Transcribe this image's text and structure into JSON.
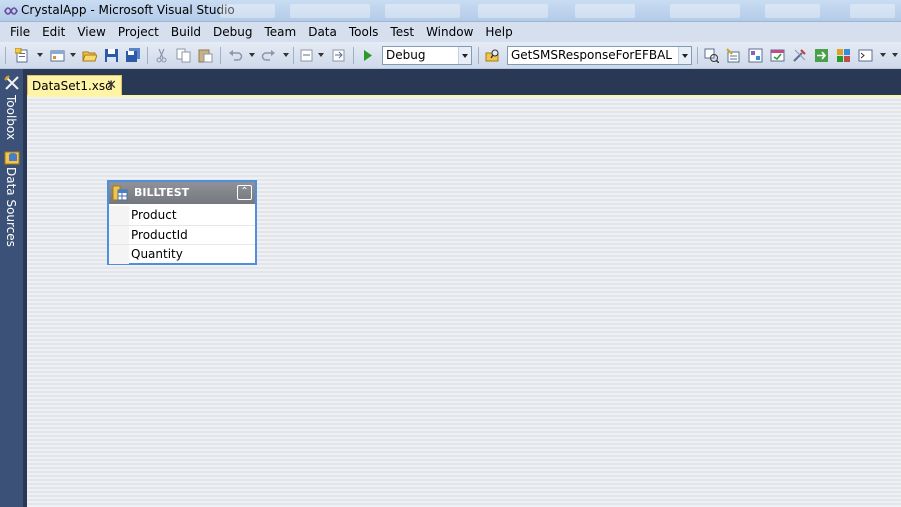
{
  "window": {
    "title": "CrystalApp - Microsoft Visual Studio"
  },
  "menu": [
    {
      "label": "File"
    },
    {
      "label": "Edit"
    },
    {
      "label": "View"
    },
    {
      "label": "Project"
    },
    {
      "label": "Build"
    },
    {
      "label": "Debug"
    },
    {
      "label": "Team"
    },
    {
      "label": "Data"
    },
    {
      "label": "Tools"
    },
    {
      "label": "Test"
    },
    {
      "label": "Window"
    },
    {
      "label": "Help"
    }
  ],
  "toolbar": {
    "configuration": "Debug",
    "find_combo": "GetSMSResponseForEFBAL"
  },
  "side_panels": {
    "toolbox": "Toolbox",
    "data_sources": "Data Sources"
  },
  "document": {
    "tab_label": "DataSet1.xsd",
    "close_glyph": "✕"
  },
  "table": {
    "name": "BILLTEST",
    "collapse_glyph": "⌃",
    "columns": [
      {
        "name": "Product"
      },
      {
        "name": "ProductId"
      },
      {
        "name": "Quantity"
      }
    ]
  },
  "colors": {
    "chrome": "#293955",
    "active_tab": "#fff3a6",
    "selection_border": "#4f8fdc"
  }
}
